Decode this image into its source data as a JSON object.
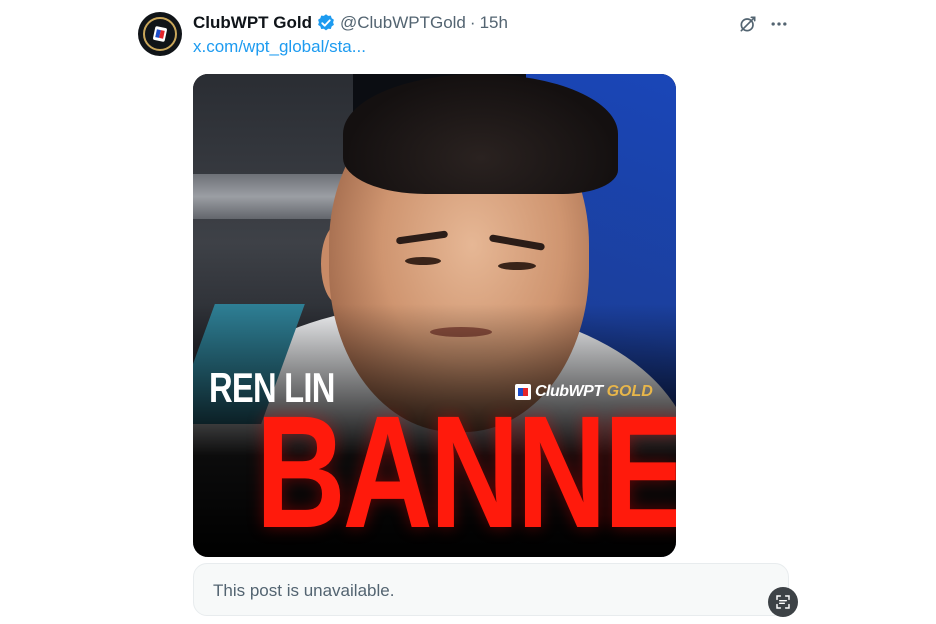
{
  "post": {
    "display_name": "ClubWPT Gold",
    "handle": "@ClubWPTGold",
    "separator": "·",
    "time": "15h",
    "link_text": "x.com/wpt_global/sta..."
  },
  "icons": {
    "avatar": "clubwpt-logo-icon",
    "verified": "verified-badge-icon",
    "grok": "grok-icon",
    "more": "more-dots-icon",
    "scan": "image-scan-icon"
  },
  "media": {
    "name_caption": "REN LIN",
    "headline": "BANNED",
    "brand_name": "ClubWPT",
    "brand_tag": "GOLD"
  },
  "quoted_post": {
    "text": "This post is unavailable."
  },
  "colors": {
    "link": "#1d9bf0",
    "verified": "#1d9bf0",
    "headline": "#ff1a0c",
    "brand_gold": "#e8b64a"
  }
}
